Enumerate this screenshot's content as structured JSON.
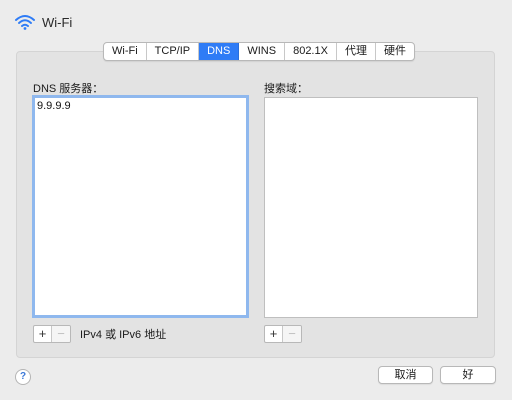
{
  "header": {
    "title": "Wi-Fi",
    "icon": "wifi-icon"
  },
  "tabs": [
    {
      "label": "Wi-Fi",
      "active": false
    },
    {
      "label": "TCP/IP",
      "active": false
    },
    {
      "label": "DNS",
      "active": true
    },
    {
      "label": "WINS",
      "active": false
    },
    {
      "label": "802.1X",
      "active": false
    },
    {
      "label": "代理",
      "active": false
    },
    {
      "label": "硬件",
      "active": false
    }
  ],
  "dns": {
    "label": "DNS 服务器：",
    "servers": [
      "9.9.9.9"
    ],
    "hint": "IPv4 或 IPv6 地址"
  },
  "search_domains": {
    "label": "搜索域：",
    "domains": []
  },
  "controls": {
    "plus": "+",
    "minus": "−"
  },
  "footer": {
    "help": "?",
    "cancel_label": "取消",
    "ok_label": "好"
  },
  "colors": {
    "accent": "#2f7cf6",
    "focus_ring": "#8fb8ee"
  }
}
